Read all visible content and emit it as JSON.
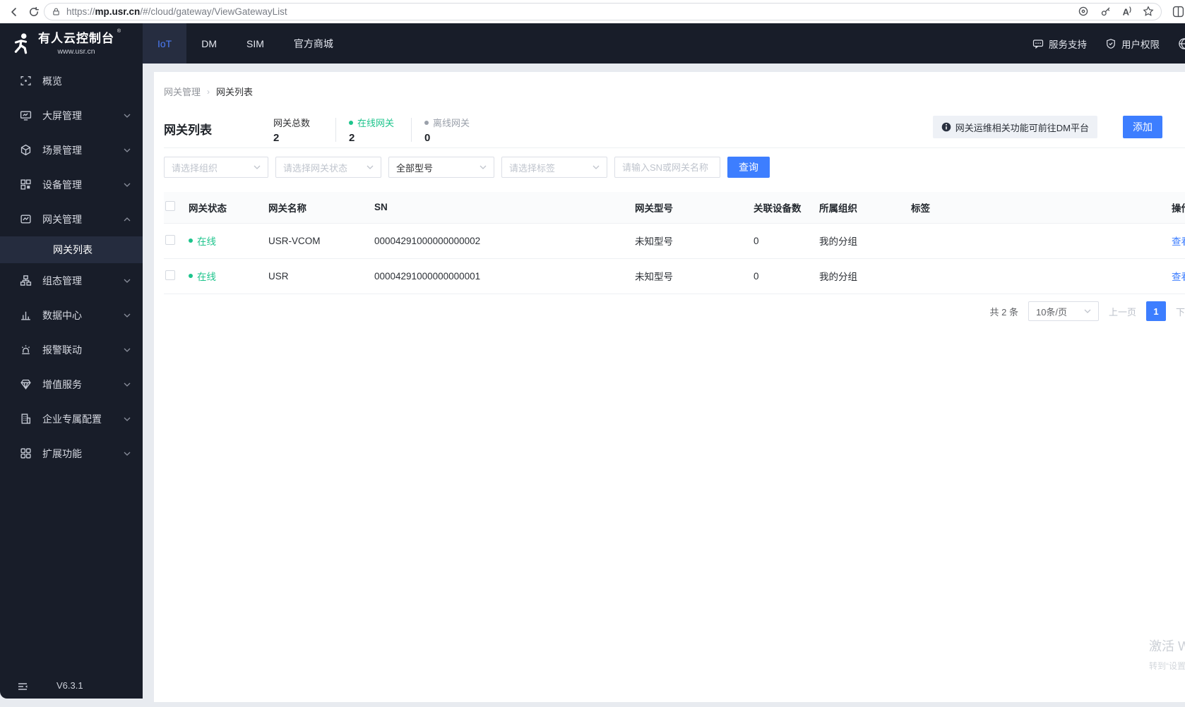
{
  "browser": {
    "url_prefix": "https://",
    "url_domain": "mp.usr.cn",
    "url_path": "/#/cloud/gateway/ViewGatewayList"
  },
  "header": {
    "logo_title": "有人云控制台",
    "logo_subtitle": "www.usr.cn",
    "tabs": [
      {
        "label": "IoT",
        "active": true
      },
      {
        "label": "DM",
        "active": false
      },
      {
        "label": "SIM",
        "active": false
      },
      {
        "label": "官方商城",
        "active": false
      }
    ],
    "right": [
      {
        "label": "服务支持",
        "icon": "chat-icon"
      },
      {
        "label": "用户权限",
        "icon": "shield-icon"
      },
      {
        "label": "",
        "icon": "globe-icon"
      }
    ]
  },
  "sidebar": {
    "items": [
      {
        "label": "概览",
        "icon": "overview-icon",
        "expandable": false
      },
      {
        "label": "大屏管理",
        "icon": "screen-icon",
        "expandable": true
      },
      {
        "label": "场景管理",
        "icon": "scene-icon",
        "expandable": true
      },
      {
        "label": "设备管理",
        "icon": "device-icon",
        "expandable": true
      },
      {
        "label": "网关管理",
        "icon": "gateway-icon",
        "expandable": true,
        "expanded": true,
        "children": [
          {
            "label": "网关列表",
            "active": true
          }
        ]
      },
      {
        "label": "组态管理",
        "icon": "sitemap-icon",
        "expandable": true
      },
      {
        "label": "数据中心",
        "icon": "barchart-icon",
        "expandable": true
      },
      {
        "label": "报警联动",
        "icon": "alarm-icon",
        "expandable": true
      },
      {
        "label": "增值服务",
        "icon": "gem-icon",
        "expandable": true
      },
      {
        "label": "企业专属配置",
        "icon": "building-icon",
        "expandable": true
      },
      {
        "label": "扩展功能",
        "icon": "grid-icon",
        "expandable": true
      }
    ],
    "version": "V6.3.1"
  },
  "breadcrumb": [
    "网关管理",
    "网关列表"
  ],
  "page": {
    "title": "网关列表",
    "stats": [
      {
        "label": "网关总数",
        "value": "2",
        "dot": "none"
      },
      {
        "label": "在线网关",
        "value": "2",
        "dot": "online"
      },
      {
        "label": "离线网关",
        "value": "0",
        "dot": "offline"
      }
    ],
    "notice": "网关运维相关功能可前往DM平台",
    "add_button": "添加"
  },
  "filters": {
    "org_placeholder": "请选择组织",
    "status_placeholder": "请选择网关状态",
    "model_value": "全部型号",
    "tag_placeholder": "请选择标签",
    "search_placeholder": "请输入SN或网关名称",
    "query_button": "查询"
  },
  "table": {
    "columns": [
      "网关状态",
      "网关名称",
      "SN",
      "网关型号",
      "关联设备数",
      "所属组织",
      "标签",
      "操作"
    ],
    "rows": [
      {
        "status": "在线",
        "name": "USR-VCOM",
        "sn": "00004291000000000002",
        "model": "未知型号",
        "devices": "0",
        "org": "我的分组",
        "tag": "",
        "action": "查看"
      },
      {
        "status": "在线",
        "name": "USR",
        "sn": "00004291000000000001",
        "model": "未知型号",
        "devices": "0",
        "org": "我的分组",
        "tag": "",
        "action": "查看"
      }
    ]
  },
  "pagination": {
    "total": "共 2 条",
    "page_size": "10条/页",
    "prev": "上一页",
    "current": "1",
    "next": "下一页"
  },
  "watermark": {
    "line1": "激活 Windows",
    "line2": "转到“设置”以激活 Windows。"
  },
  "colors": {
    "accent_blue": "#3d7eff",
    "online_green": "#1dc48c",
    "offline_gray": "#9aa0aa",
    "dark_bg": "#181d29"
  }
}
